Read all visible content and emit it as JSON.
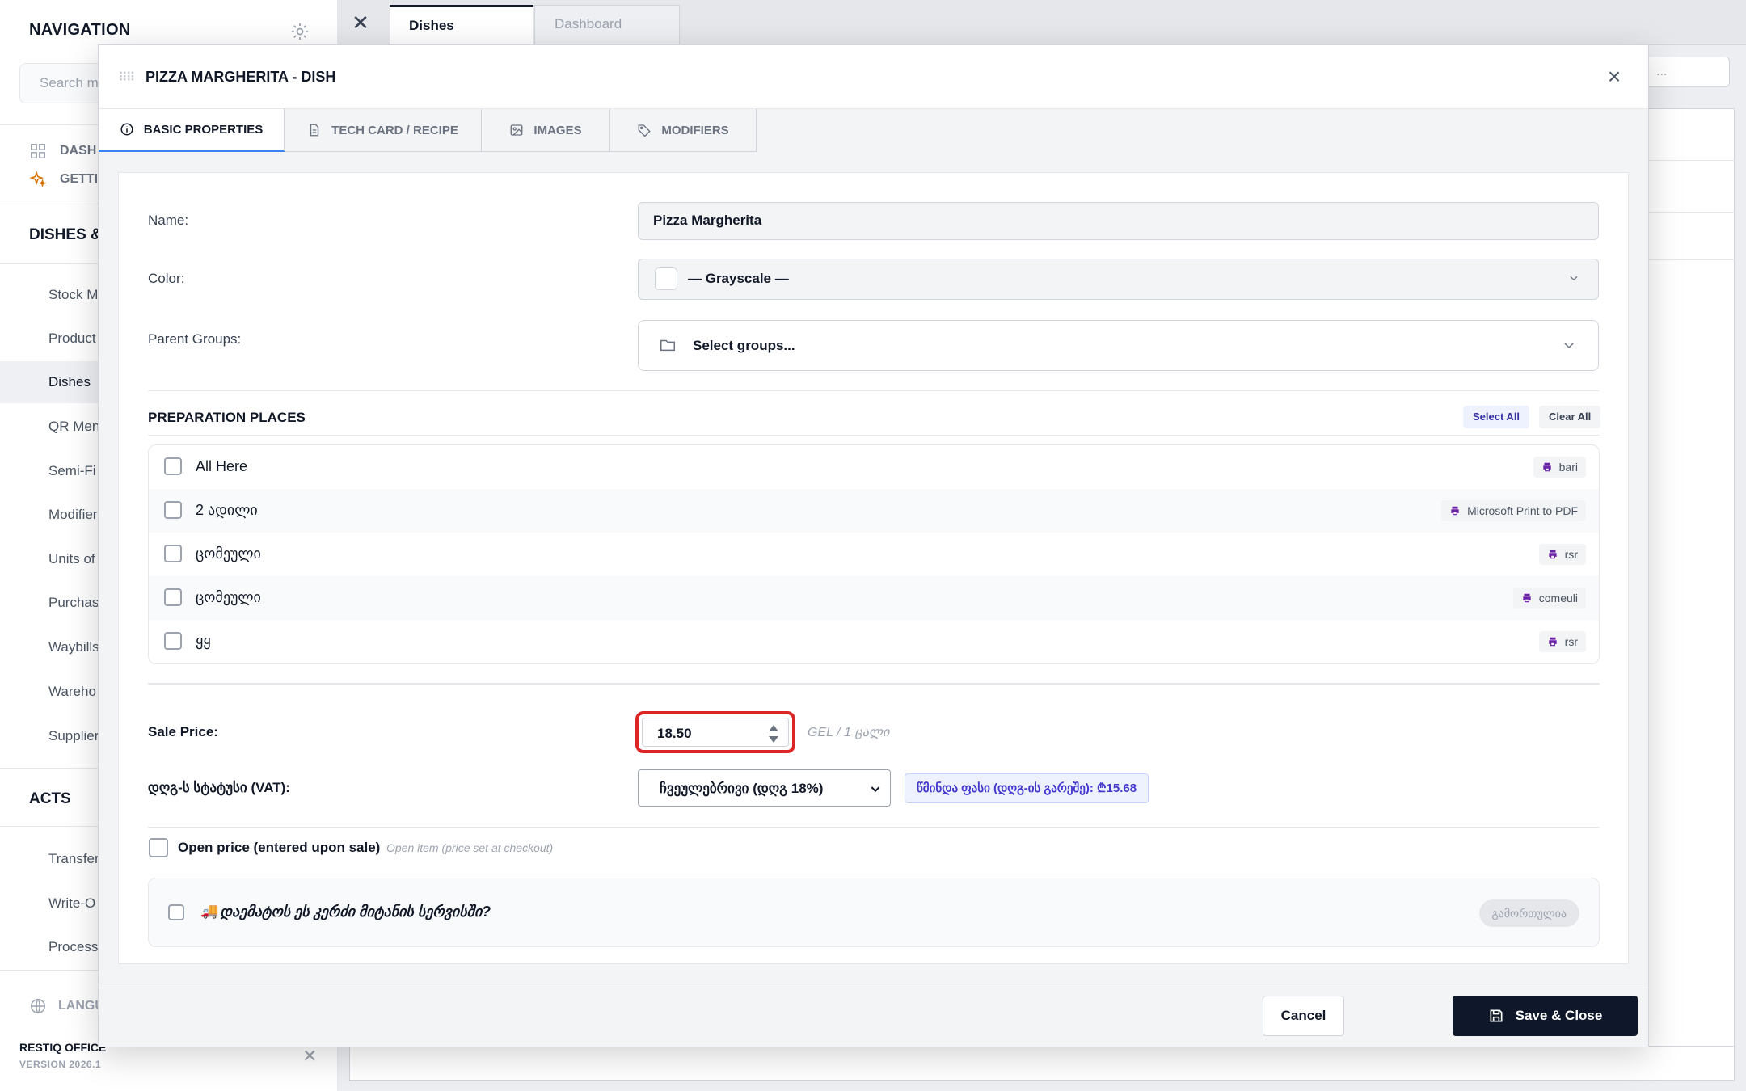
{
  "sidebar": {
    "title": "NAVIGATION",
    "search_placeholder": "Search m",
    "top_items": [
      "DASH",
      "GETTI"
    ],
    "section_dishes": "DISHES &",
    "items": [
      "Stock M",
      "Product",
      "Dishes",
      "QR Men",
      "Semi-Fi",
      "Modifier",
      "Units of",
      "Purchas",
      "Waybills",
      "Wareho",
      "Supplier"
    ],
    "section_acts": "ACTS",
    "act_items": [
      "Transfer",
      "Write-O",
      "Processi"
    ],
    "language_label": "LANGU",
    "brand": "RESTIQ OFFICE",
    "version": "VERSION 2026.1"
  },
  "tabs": {
    "active": "Dishes",
    "inactive": "Dashboard"
  },
  "background": {
    "search_placeholder": "..."
  },
  "modal": {
    "title": "PIZZA MARGHERITA - DISH",
    "tabs": [
      "BASIC PROPERTIES",
      "TECH CARD / RECIPE",
      "IMAGES",
      "MODIFIERS"
    ],
    "name_label": "Name:",
    "name_value": "Pizza Margherita",
    "color_label": "Color:",
    "color_value": "— Grayscale —",
    "parent_label": "Parent Groups:",
    "parent_placeholder": "Select groups...",
    "prep_heading": "PREPARATION PLACES",
    "select_all": "Select All",
    "clear_all": "Clear All",
    "prep_places": [
      {
        "name": "All Here",
        "printer": "bari"
      },
      {
        "name": "2 ადილი",
        "printer": "Microsoft Print to PDF"
      },
      {
        "name": "ცომეული",
        "printer": "rsr"
      },
      {
        "name": "ცომეული",
        "printer": "comeuli"
      },
      {
        "name": "ყყ",
        "printer": "rsr"
      }
    ],
    "sale_price_label": "Sale Price:",
    "sale_price_value": "18.50",
    "sale_price_unit": "GEL / 1 ცალი",
    "vat_label": "დღგ-ს სტატუსი (VAT):",
    "vat_value": "ჩვეულებრივი (დღგ 18%)",
    "vat_net": "წმინდა ფასი (დღგ-ის გარეშე): ₾15.68",
    "open_price_label": "Open price (entered upon sale)",
    "open_price_hint": "Open item (price set at checkout)",
    "delivery_question": "დაემატოს ეს კერძი მიტანის სერვისში?",
    "delivery_status": "გამორთულია",
    "cancel": "Cancel",
    "save_close": "Save & Close"
  },
  "colors": {
    "accent": "#3b82f6",
    "highlight": "#dc2626",
    "primary_button": "#0f172a"
  }
}
